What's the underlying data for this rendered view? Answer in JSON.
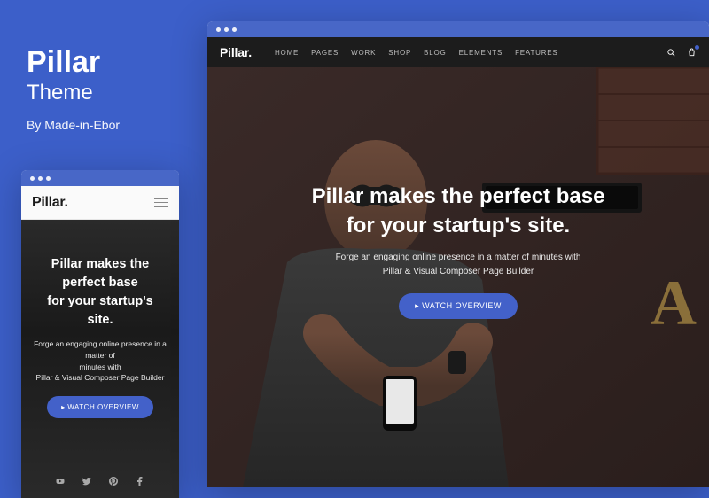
{
  "title": {
    "main": "Pillar",
    "sub": "Theme",
    "author": "By Made-in-Ebor"
  },
  "logo": "Pillar.",
  "nav": {
    "items": [
      "HOME",
      "PAGES",
      "WORK",
      "SHOP",
      "BLOG",
      "ELEMENTS",
      "FEATURES"
    ]
  },
  "hero": {
    "headline_l1": "Pillar makes the perfect base",
    "headline_l2": "for your startup's site.",
    "tagline_l1": "Forge an engaging online presence in a matter of minutes with",
    "tagline_l2": "Pillar & Visual Composer Page Builder",
    "cta": "▸ WATCH OVERVIEW"
  },
  "mobile_hero": {
    "headline_l1": "Pillar makes the",
    "headline_l2": "perfect base",
    "headline_l3": "for your startup's site.",
    "tagline_l1": "Forge an engaging online presence in a matter of",
    "tagline_l2": "minutes with",
    "tagline_l3": "Pillar & Visual Composer Page Builder",
    "cta": "▸ WATCH OVERVIEW"
  },
  "colors": {
    "page_bg": "#3c5fc9",
    "accent": "#4361c9",
    "dark": "#1a1a1a"
  }
}
